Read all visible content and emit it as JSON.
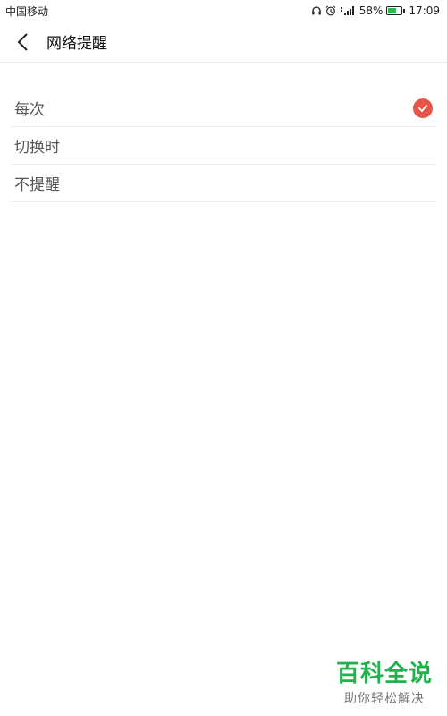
{
  "status_bar": {
    "carrier": "中国移动",
    "battery_percent": "58%",
    "battery_level": 0.58,
    "time": "17:09",
    "icons": [
      "headphones-icon",
      "alarm-icon",
      "signal-icon",
      "battery-icon"
    ]
  },
  "header": {
    "back_icon": "chevron-left-icon",
    "title": "网络提醒"
  },
  "options": [
    {
      "label": "每次",
      "selected": true
    },
    {
      "label": "切换时",
      "selected": false
    },
    {
      "label": "不提醒",
      "selected": false
    }
  ],
  "watermark": {
    "title": "百科全说",
    "subtitle": "助你轻松解决"
  },
  "colors": {
    "accent": "#e6554a",
    "watermark_green": "#22b14c",
    "battery_green": "#2eb84b"
  }
}
